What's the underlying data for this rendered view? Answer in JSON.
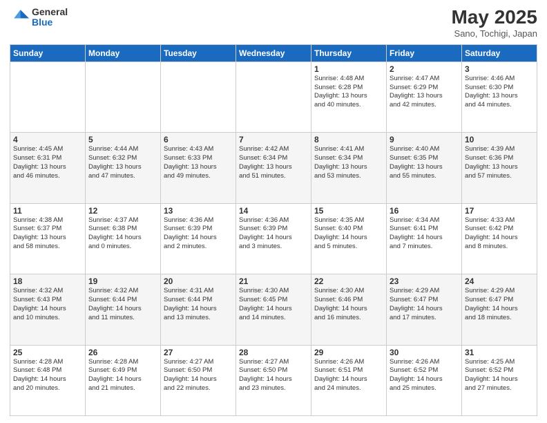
{
  "header": {
    "logo_line1": "General",
    "logo_line2": "Blue",
    "title": "May 2025",
    "subtitle": "Sano, Tochigi, Japan"
  },
  "weekdays": [
    "Sunday",
    "Monday",
    "Tuesday",
    "Wednesday",
    "Thursday",
    "Friday",
    "Saturday"
  ],
  "weeks": [
    [
      {
        "day": "",
        "info": ""
      },
      {
        "day": "",
        "info": ""
      },
      {
        "day": "",
        "info": ""
      },
      {
        "day": "",
        "info": ""
      },
      {
        "day": "1",
        "info": "Sunrise: 4:48 AM\nSunset: 6:28 PM\nDaylight: 13 hours\nand 40 minutes."
      },
      {
        "day": "2",
        "info": "Sunrise: 4:47 AM\nSunset: 6:29 PM\nDaylight: 13 hours\nand 42 minutes."
      },
      {
        "day": "3",
        "info": "Sunrise: 4:46 AM\nSunset: 6:30 PM\nDaylight: 13 hours\nand 44 minutes."
      }
    ],
    [
      {
        "day": "4",
        "info": "Sunrise: 4:45 AM\nSunset: 6:31 PM\nDaylight: 13 hours\nand 46 minutes."
      },
      {
        "day": "5",
        "info": "Sunrise: 4:44 AM\nSunset: 6:32 PM\nDaylight: 13 hours\nand 47 minutes."
      },
      {
        "day": "6",
        "info": "Sunrise: 4:43 AM\nSunset: 6:33 PM\nDaylight: 13 hours\nand 49 minutes."
      },
      {
        "day": "7",
        "info": "Sunrise: 4:42 AM\nSunset: 6:34 PM\nDaylight: 13 hours\nand 51 minutes."
      },
      {
        "day": "8",
        "info": "Sunrise: 4:41 AM\nSunset: 6:34 PM\nDaylight: 13 hours\nand 53 minutes."
      },
      {
        "day": "9",
        "info": "Sunrise: 4:40 AM\nSunset: 6:35 PM\nDaylight: 13 hours\nand 55 minutes."
      },
      {
        "day": "10",
        "info": "Sunrise: 4:39 AM\nSunset: 6:36 PM\nDaylight: 13 hours\nand 57 minutes."
      }
    ],
    [
      {
        "day": "11",
        "info": "Sunrise: 4:38 AM\nSunset: 6:37 PM\nDaylight: 13 hours\nand 58 minutes."
      },
      {
        "day": "12",
        "info": "Sunrise: 4:37 AM\nSunset: 6:38 PM\nDaylight: 14 hours\nand 0 minutes."
      },
      {
        "day": "13",
        "info": "Sunrise: 4:36 AM\nSunset: 6:39 PM\nDaylight: 14 hours\nand 2 minutes."
      },
      {
        "day": "14",
        "info": "Sunrise: 4:36 AM\nSunset: 6:39 PM\nDaylight: 14 hours\nand 3 minutes."
      },
      {
        "day": "15",
        "info": "Sunrise: 4:35 AM\nSunset: 6:40 PM\nDaylight: 14 hours\nand 5 minutes."
      },
      {
        "day": "16",
        "info": "Sunrise: 4:34 AM\nSunset: 6:41 PM\nDaylight: 14 hours\nand 7 minutes."
      },
      {
        "day": "17",
        "info": "Sunrise: 4:33 AM\nSunset: 6:42 PM\nDaylight: 14 hours\nand 8 minutes."
      }
    ],
    [
      {
        "day": "18",
        "info": "Sunrise: 4:32 AM\nSunset: 6:43 PM\nDaylight: 14 hours\nand 10 minutes."
      },
      {
        "day": "19",
        "info": "Sunrise: 4:32 AM\nSunset: 6:44 PM\nDaylight: 14 hours\nand 11 minutes."
      },
      {
        "day": "20",
        "info": "Sunrise: 4:31 AM\nSunset: 6:44 PM\nDaylight: 14 hours\nand 13 minutes."
      },
      {
        "day": "21",
        "info": "Sunrise: 4:30 AM\nSunset: 6:45 PM\nDaylight: 14 hours\nand 14 minutes."
      },
      {
        "day": "22",
        "info": "Sunrise: 4:30 AM\nSunset: 6:46 PM\nDaylight: 14 hours\nand 16 minutes."
      },
      {
        "day": "23",
        "info": "Sunrise: 4:29 AM\nSunset: 6:47 PM\nDaylight: 14 hours\nand 17 minutes."
      },
      {
        "day": "24",
        "info": "Sunrise: 4:29 AM\nSunset: 6:47 PM\nDaylight: 14 hours\nand 18 minutes."
      }
    ],
    [
      {
        "day": "25",
        "info": "Sunrise: 4:28 AM\nSunset: 6:48 PM\nDaylight: 14 hours\nand 20 minutes."
      },
      {
        "day": "26",
        "info": "Sunrise: 4:28 AM\nSunset: 6:49 PM\nDaylight: 14 hours\nand 21 minutes."
      },
      {
        "day": "27",
        "info": "Sunrise: 4:27 AM\nSunset: 6:50 PM\nDaylight: 14 hours\nand 22 minutes."
      },
      {
        "day": "28",
        "info": "Sunrise: 4:27 AM\nSunset: 6:50 PM\nDaylight: 14 hours\nand 23 minutes."
      },
      {
        "day": "29",
        "info": "Sunrise: 4:26 AM\nSunset: 6:51 PM\nDaylight: 14 hours\nand 24 minutes."
      },
      {
        "day": "30",
        "info": "Sunrise: 4:26 AM\nSunset: 6:52 PM\nDaylight: 14 hours\nand 25 minutes."
      },
      {
        "day": "31",
        "info": "Sunrise: 4:25 AM\nSunset: 6:52 PM\nDaylight: 14 hours\nand 27 minutes."
      }
    ]
  ]
}
